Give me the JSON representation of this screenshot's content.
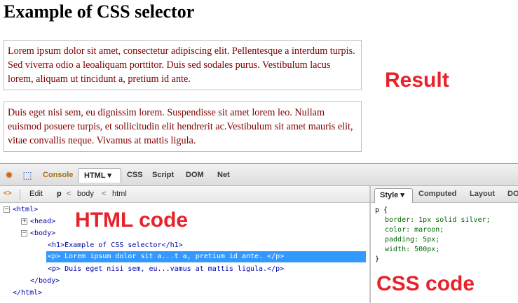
{
  "page": {
    "title": "Example of CSS selector",
    "paragraph1": "Lorem ipsum dolor sit amet, consectetur adipiscing elit. Pellentesque a interdum turpis. Sed viverra odio a leoaliquam porttitor. Duis sed sodales purus. Vestibulum lacus lorem, aliquam ut tincidunt a, pretium id ante.",
    "paragraph2": "Duis eget nisi sem, eu dignissim lorem. Suspendisse sit amet lorem leo. Nullam euismod posuere turpis, et sollicitudin elit hendrerit ac.Vestibulum sit amet mauris elit, vitae convallis neque. Vivamus at mattis ligula."
  },
  "annotations": {
    "result": "Result",
    "html_code": "HTML code",
    "css_code": "CSS code"
  },
  "devtools": {
    "toolbar": {
      "bug_icon": "firebug-icon",
      "inspect_icon": "inspect-icon",
      "tabs": [
        "Console",
        "HTML ▾",
        "CSS",
        "Script",
        "DOM",
        "Net"
      ]
    },
    "breadcrumb": {
      "edit": "Edit",
      "items": [
        "p",
        "body",
        "html"
      ],
      "separator": "<"
    },
    "html_tree": {
      "lines": [
        "<html>",
        "<head>",
        "<body>",
        "<h1>Example of CSS selector</h1>",
        "<p> Lorem ipsum dolor sit a...t a, pretium id ante. </p>",
        "<p> Duis eget nisi sem, eu...vamus at mattis ligula.</p>",
        "</body>",
        "</html>"
      ]
    },
    "side_panel": {
      "tabs": [
        "Style ▾",
        "Computed",
        "Layout",
        "DOM"
      ],
      "css_lines": [
        "p {",
        "border: 1px solid silver;",
        "color: maroon;",
        "padding: 5px;",
        "width: 500px;",
        "}"
      ]
    }
  }
}
